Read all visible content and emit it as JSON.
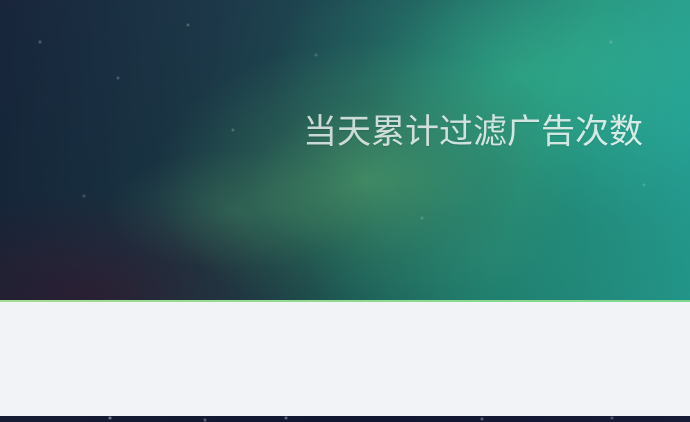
{
  "hero": {
    "title": "当天累计过滤广告次数"
  }
}
